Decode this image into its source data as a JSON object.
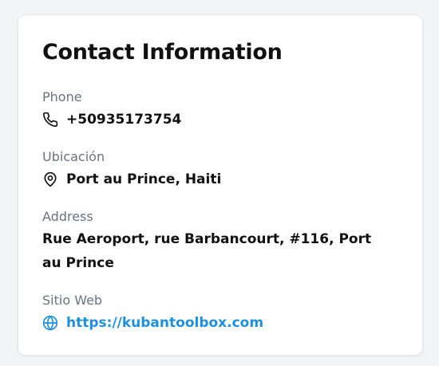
{
  "card": {
    "title": "Contact Information",
    "phone": {
      "label": "Phone",
      "value": "+50935173754",
      "icon": "phone-icon"
    },
    "location": {
      "label": "Ubicación",
      "value": "Port au Prince, Haiti",
      "icon": "map-pin-icon"
    },
    "address": {
      "label": "Address",
      "value": "Rue Aeroport, rue Barbancourt, #116, Port au Prince"
    },
    "website": {
      "label": "Sitio Web",
      "value": "https://kubantoolbox.com",
      "icon": "globe-icon"
    }
  },
  "colors": {
    "label": "#6b7280",
    "text": "#111111",
    "link": "#1d8fe1",
    "card_border": "#e5e7eb"
  }
}
